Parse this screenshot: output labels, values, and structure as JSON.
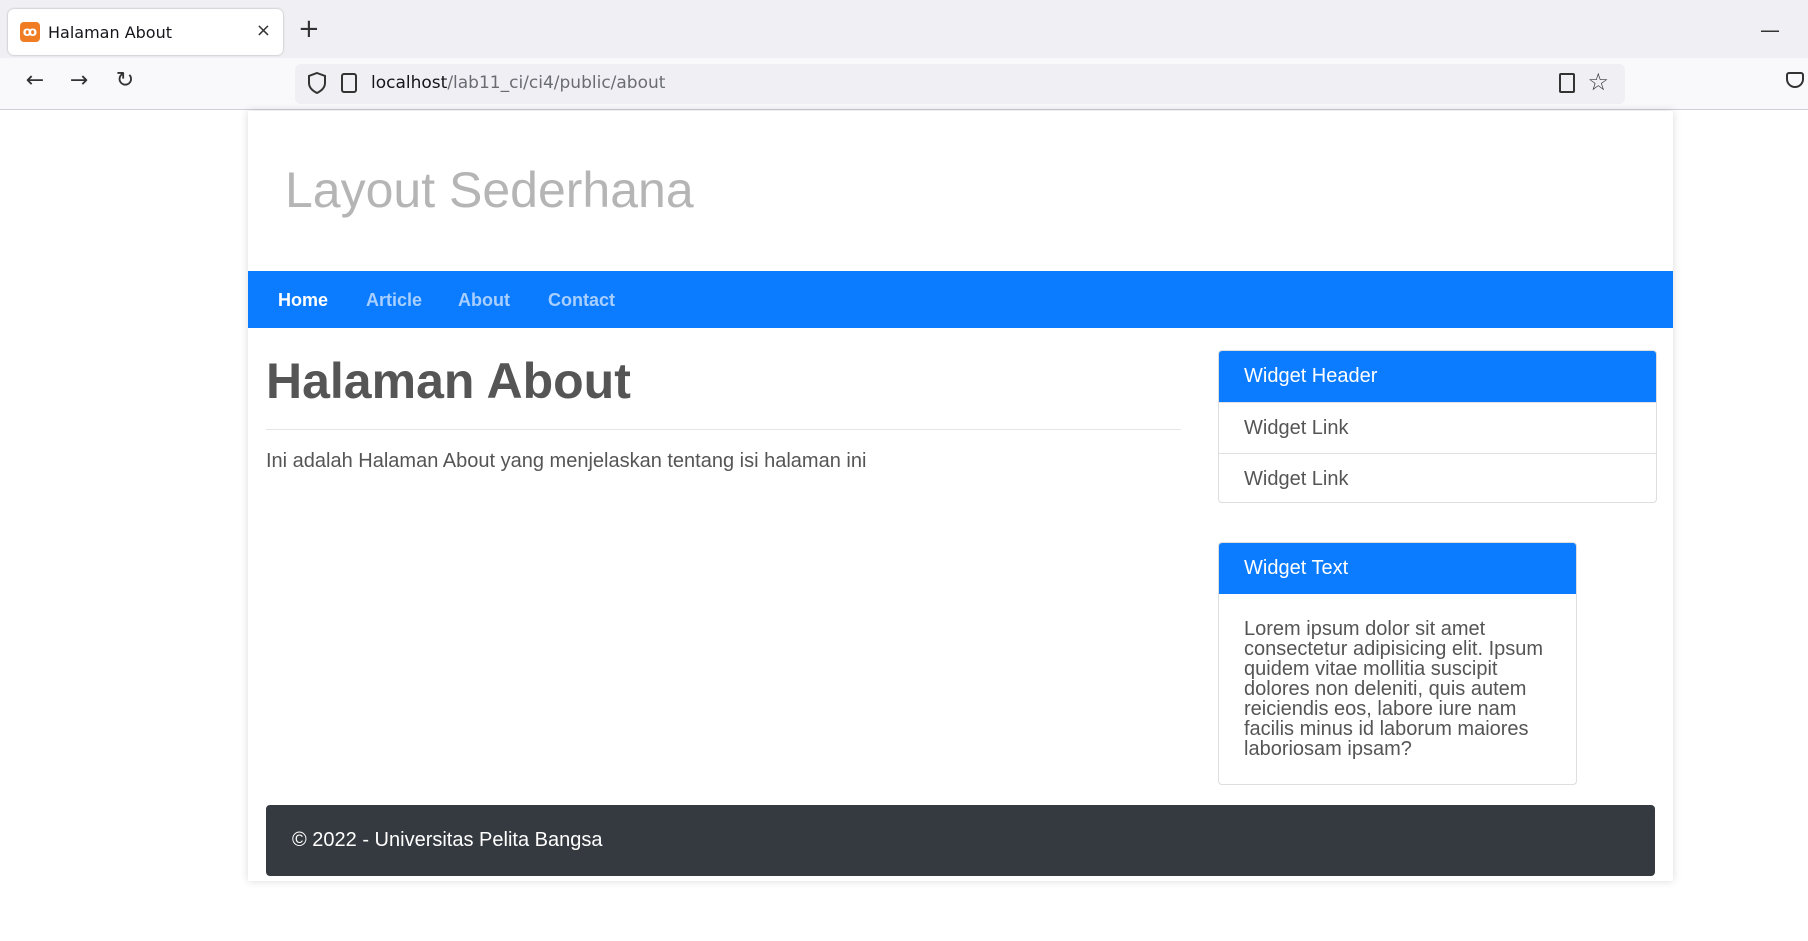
{
  "browser": {
    "tab_title": "Halaman About",
    "tab_favicon_glyph": "ꝏ",
    "tab_close": "×",
    "new_tab": "+",
    "minimize": "—",
    "back": "←",
    "forward": "→",
    "reload": "↻",
    "url_host": "localhost",
    "url_path": "/lab11_ci/ci4/public/about",
    "bookmark_star": "☆"
  },
  "site": {
    "title": "Layout Sederhana",
    "menu": [
      {
        "label": "Home",
        "active": true
      },
      {
        "label": "Article",
        "active": false
      },
      {
        "label": "About",
        "active": false
      },
      {
        "label": "Contact",
        "active": false
      }
    ]
  },
  "main": {
    "heading": "Halaman About",
    "text": "Ini adalah Halaman About yang menjelaskan tentang isi halaman ini"
  },
  "sidebar": {
    "widget1": {
      "header": "Widget Header",
      "links": [
        "Widget Link",
        "Widget Link"
      ]
    },
    "widget2": {
      "header": "Widget Text",
      "body": "Lorem ipsum dolor sit amet consectetur adipisicing elit. Ipsum quidem vitae mollitia suscipit dolores non deleniti, quis autem reiciendis eos, labore iure nam facilis minus id laborum maiores laboriosam ipsam?"
    }
  },
  "footer": {
    "text": "© 2022 - Universitas Pelita Bangsa"
  },
  "colors": {
    "accent": "#0b7bff",
    "footer_bg": "#353a40",
    "title_gray": "#b5b5b5",
    "text_gray": "#555555"
  }
}
